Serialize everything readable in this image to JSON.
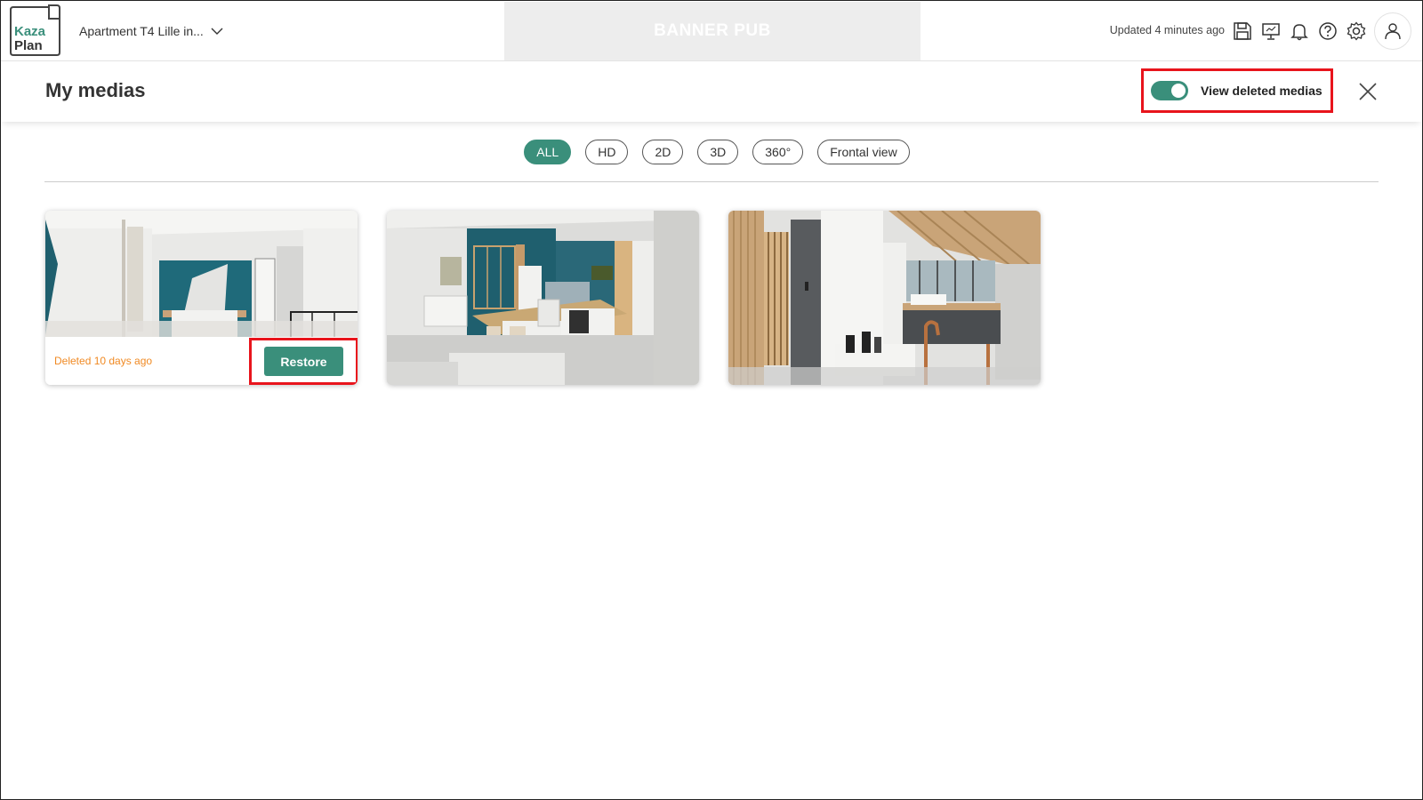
{
  "app": {
    "logo_line1": "Kaza",
    "logo_line2": "Plan",
    "project_name": "Apartment T4 Lille in...",
    "banner_text": "BANNER PUB",
    "updated_text": "Updated 4 minutes ago",
    "toolbar_icons": [
      "save-icon",
      "presentation-icon",
      "bell-icon",
      "help-icon",
      "gear-icon",
      "user-icon"
    ]
  },
  "header": {
    "title": "My medias",
    "toggle_label": "View deleted medias",
    "toggle_on": true
  },
  "filters": {
    "items": [
      {
        "label": "ALL",
        "active": true
      },
      {
        "label": "HD",
        "active": false
      },
      {
        "label": "2D",
        "active": false
      },
      {
        "label": "3D",
        "active": false
      },
      {
        "label": "360°",
        "active": false
      },
      {
        "label": "Frontal view",
        "active": false
      }
    ]
  },
  "medias": [
    {
      "scene": "bedroom",
      "deleted": true,
      "deleted_text": "Deleted 10 days ago",
      "restore_label": "Restore"
    },
    {
      "scene": "kitchen",
      "deleted": false
    },
    {
      "scene": "bathroom",
      "deleted": false
    }
  ],
  "colors": {
    "accent": "#3a8f7b",
    "deleted_text": "#f08a24",
    "highlight": "#e8141c",
    "banner_bg": "#ededed"
  }
}
